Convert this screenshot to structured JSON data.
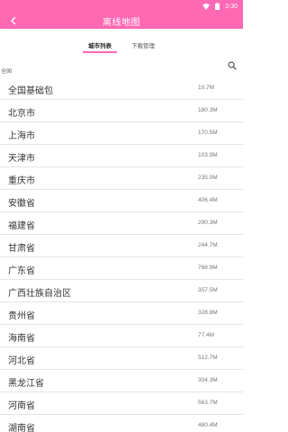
{
  "status_bar": {
    "time": "2:30",
    "icons": [
      "wifi-icon",
      "battery-icon"
    ]
  },
  "app_bar": {
    "title": "离线地图",
    "back_icon": "back-arrow-icon"
  },
  "tabs": [
    {
      "label": "城市列表",
      "active": true
    },
    {
      "label": "下载管理",
      "active": false
    }
  ],
  "section": {
    "label": "全国",
    "search_icon": "search-icon"
  },
  "cities": [
    {
      "name": "全国基础包",
      "size": "10.7M"
    },
    {
      "name": "北京市",
      "size": "180.3M"
    },
    {
      "name": "上海市",
      "size": "170.5M"
    },
    {
      "name": "天津市",
      "size": "103.9M"
    },
    {
      "name": "重庆市",
      "size": "235.0M"
    },
    {
      "name": "安徽省",
      "size": "406.4M"
    },
    {
      "name": "福建省",
      "size": "290.3M"
    },
    {
      "name": "甘肃省",
      "size": "244.7M"
    },
    {
      "name": "广东省",
      "size": "768.9M"
    },
    {
      "name": "广西壮族自治区",
      "size": "357.5M"
    },
    {
      "name": "贵州省",
      "size": "328.8M"
    },
    {
      "name": "海南省",
      "size": "77.4M"
    },
    {
      "name": "河北省",
      "size": "512.7M"
    },
    {
      "name": "黑龙江省",
      "size": "304.3M"
    },
    {
      "name": "河南省",
      "size": "563.7M"
    },
    {
      "name": "湖南省",
      "size": "480.4M"
    }
  ],
  "colors": {
    "accent": "#ff69b4",
    "divider": "#e4e4e4"
  }
}
